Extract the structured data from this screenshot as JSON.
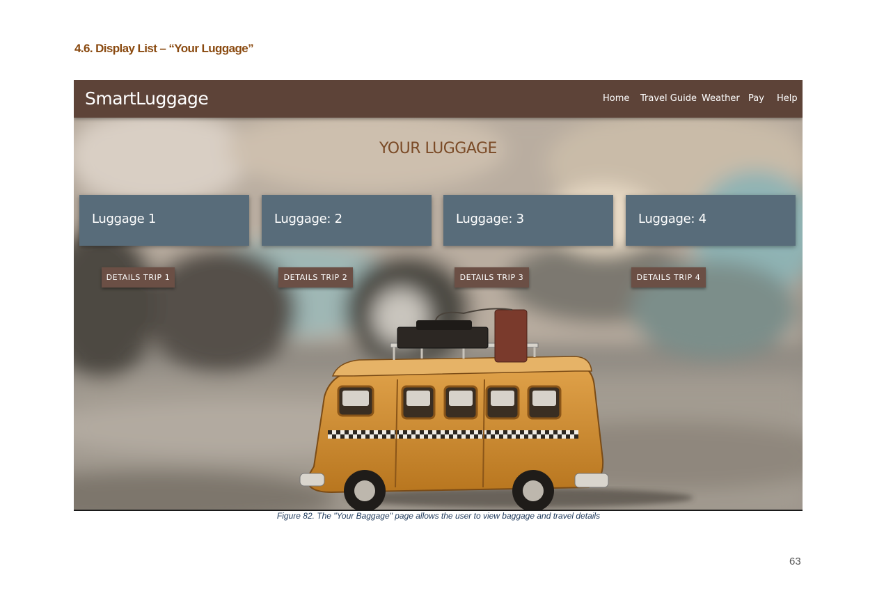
{
  "section_heading": "4.6. Display List – “Your Luggage”",
  "app": {
    "brand": "SmartLuggage",
    "nav": [
      "Home",
      "Travel Guide",
      "Weather",
      "Pay",
      "Help"
    ],
    "page_title": "YOUR LUGGAGE",
    "cards": [
      "Luggage 1",
      "Luggage: 2",
      "Luggage: 3",
      "Luggage: 4"
    ],
    "buttons": [
      "DETAILS TRIP 1",
      "DETAILS TRIP 2",
      "DETAILS TRIP 3",
      "DETAILS TRIP 4"
    ]
  },
  "caption": "Figure 82. The \"Your Baggage\" page allows the user to view baggage and travel details",
  "page_number": "63",
  "colors": {
    "heading": "#8a4a10",
    "navbar": "#5d4338",
    "card": "#586c7a",
    "button": "#6b4f45",
    "title": "#7a4a26",
    "caption": "#1f3a5c"
  }
}
